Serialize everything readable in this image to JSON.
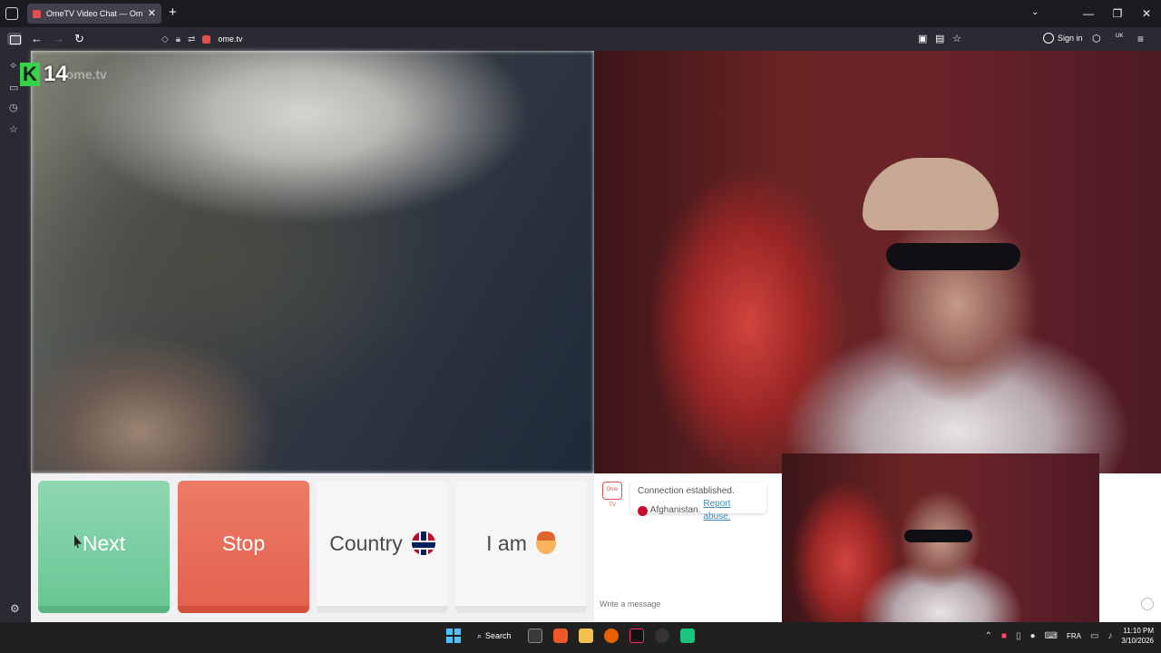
{
  "browser": {
    "tab_title": "OmeTV Video Chat — Omegle",
    "url": "ome.tv",
    "signin_label": "Sign in",
    "new_tab_symbol": "+",
    "tab_close_symbol": "✕",
    "minimize_symbol": "—",
    "maximize_symbol": "❐",
    "close_symbol": "✕",
    "list_tabs_symbol": "⌄",
    "profile_badge": "UK"
  },
  "overlay": {
    "channel_mark": "K",
    "channel_number": "14",
    "watermark": "ome.tv"
  },
  "controls": {
    "next_label": "Next",
    "stop_label": "Stop",
    "country_label": "Country",
    "iam_label": "I am"
  },
  "chat": {
    "avatar_text": "Ome TV",
    "status_message": "Connection established.",
    "country": "Afghanistan.",
    "report_link": "Report abuse.",
    "input_placeholder": "Write a message"
  },
  "taskbar": {
    "search_label": "Search",
    "language": "FRA",
    "time": "11:10 PM",
    "date": "3/10/2026"
  },
  "colors": {
    "next": "#69c795",
    "stop": "#e4634f",
    "accent_green": "#37d14a"
  }
}
